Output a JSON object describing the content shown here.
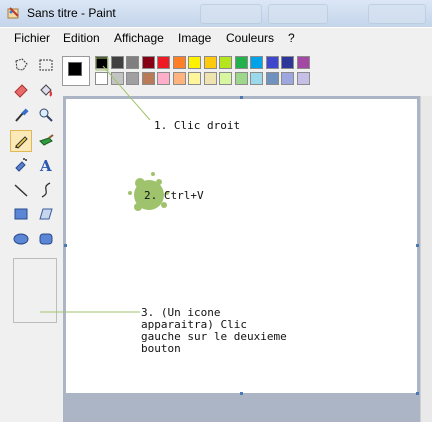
{
  "window": {
    "title": "Sans titre - Paint"
  },
  "menu": {
    "items": [
      "Fichier",
      "Edition",
      "Affichage",
      "Image",
      "Couleurs",
      "?"
    ]
  },
  "tools": {
    "items": [
      {
        "name": "free-select-icon"
      },
      {
        "name": "rect-select-icon"
      },
      {
        "name": "eraser-icon"
      },
      {
        "name": "fill-bucket-icon"
      },
      {
        "name": "color-picker-icon"
      },
      {
        "name": "magnifier-icon"
      },
      {
        "name": "pencil-icon",
        "active": true
      },
      {
        "name": "brush-icon"
      },
      {
        "name": "airbrush-icon"
      },
      {
        "name": "text-icon"
      },
      {
        "name": "line-icon"
      },
      {
        "name": "curve-icon"
      },
      {
        "name": "rectangle-icon"
      },
      {
        "name": "polygon-icon"
      },
      {
        "name": "ellipse-icon"
      },
      {
        "name": "rounded-rect-icon"
      }
    ]
  },
  "colors": {
    "foreground": "#000000",
    "background": "#ffffff",
    "palette_row1": [
      "#000000",
      "#404040",
      "#7f7f7f",
      "#880015",
      "#ed1c24",
      "#ff7f27",
      "#fff200",
      "#ffc90e",
      "#b5e61d",
      "#22b14c",
      "#00a2e8",
      "#3f48cc",
      "#2f3699",
      "#a349a4"
    ],
    "palette_row2": [
      "#ffffff",
      "#c3c3c3",
      "#a0a0a0",
      "#b97a57",
      "#ffaec9",
      "#ffb480",
      "#fff59b",
      "#efe4b0",
      "#d8f5a0",
      "#9ed68b",
      "#99d9ea",
      "#7092be",
      "#9ea6e0",
      "#c8bfe7"
    ]
  },
  "annotations": {
    "step1": "1. Clic droit",
    "step2": "2. Ctrl+V",
    "step3": "3. (Un icone\napparaitra) Clic\ngauche sur le deuxieme\nbouton",
    "accent": "#9fc36c"
  }
}
